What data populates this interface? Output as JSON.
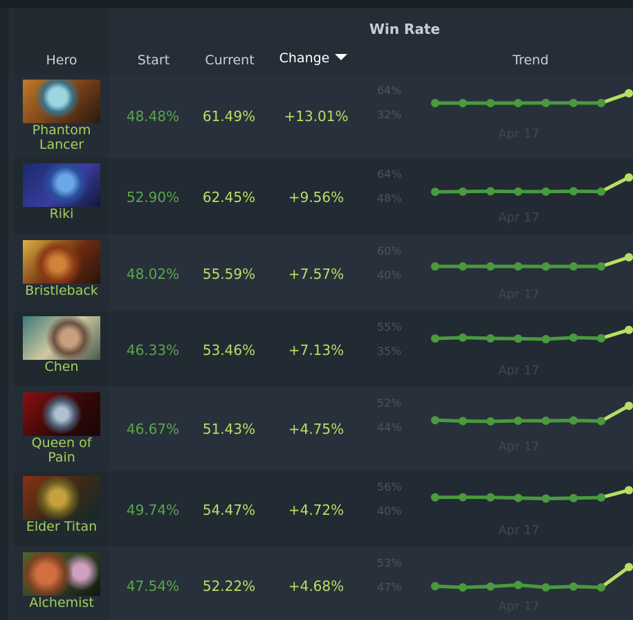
{
  "header": {
    "group_title": "Win Rate",
    "columns": {
      "hero": "Hero",
      "start": "Start",
      "current": "Current",
      "change": "Change",
      "trend": "Trend"
    },
    "sort_indicator": "caret-down-icon"
  },
  "colors": {
    "background": "#1e252d",
    "start_value": "#5aa64c",
    "current_value": "#b5e063",
    "hero_name": "#a4d25a",
    "trend_line": "#4a9a3e",
    "trend_last_segment": "#b5e063"
  },
  "rows": [
    {
      "hero": [
        "Phantom",
        "Lancer"
      ],
      "start": "48.48%",
      "current": "61.49%",
      "change": "+13.01%",
      "trend": {
        "ymax_label": "64%",
        "ymin_label": "32%",
        "ymax": 64,
        "ymin": 32,
        "date_label": "Apr 17",
        "values": [
          48.5,
          48.5,
          48.5,
          48.5,
          48.7,
          48.7,
          48.6,
          61.49
        ]
      }
    },
    {
      "hero": [
        "Riki"
      ],
      "start": "52.90%",
      "current": "62.45%",
      "change": "+9.56%",
      "trend": {
        "ymax_label": "64%",
        "ymin_label": "48%",
        "ymax": 64,
        "ymin": 48,
        "date_label": "Apr 17",
        "values": [
          52.9,
          53.1,
          53.3,
          53.1,
          53.1,
          53.3,
          53.1,
          62.45
        ]
      }
    },
    {
      "hero": [
        "Bristleback"
      ],
      "start": "48.02%",
      "current": "55.59%",
      "change": "+7.57%",
      "trend": {
        "ymax_label": "60%",
        "ymin_label": "40%",
        "ymax": 60,
        "ymin": 40,
        "date_label": "Apr 17",
        "values": [
          48.0,
          48.0,
          48.0,
          48.0,
          47.9,
          48.0,
          48.0,
          55.59
        ]
      }
    },
    {
      "hero": [
        "Chen"
      ],
      "start": "46.33%",
      "current": "53.46%",
      "change": "+7.13%",
      "trend": {
        "ymax_label": "55%",
        "ymin_label": "35%",
        "ymax": 55,
        "ymin": 35,
        "date_label": "Apr 17",
        "values": [
          46.3,
          47.1,
          46.4,
          46.2,
          45.8,
          47.1,
          46.5,
          53.46
        ]
      }
    },
    {
      "hero": [
        "Queen of",
        "Pain"
      ],
      "start": "46.67%",
      "current": "51.43%",
      "change": "+4.75%",
      "trend": {
        "ymax_label": "52%",
        "ymin_label": "44%",
        "ymax": 52,
        "ymin": 44,
        "date_label": "Apr 17",
        "values": [
          46.7,
          46.4,
          46.3,
          46.5,
          46.5,
          46.6,
          46.4,
          51.43
        ]
      }
    },
    {
      "hero": [
        "Elder Titan"
      ],
      "start": "49.74%",
      "current": "54.47%",
      "change": "+4.72%",
      "trend": {
        "ymax_label": "56%",
        "ymin_label": "40%",
        "ymax": 56,
        "ymin": 40,
        "date_label": "Apr 17",
        "values": [
          49.7,
          49.8,
          49.7,
          49.3,
          48.9,
          49.2,
          49.6,
          54.47
        ]
      }
    },
    {
      "hero": [
        "Alchemist"
      ],
      "start": "47.54%",
      "current": "52.22%",
      "change": "+4.68%",
      "trend": {
        "ymax_label": "53%",
        "ymin_label": "47%",
        "ymax": 53,
        "ymin": 47,
        "date_label": "Apr 17",
        "values": [
          47.5,
          47.2,
          47.4,
          47.8,
          47.2,
          47.4,
          47.2,
          52.22
        ]
      }
    }
  ]
}
